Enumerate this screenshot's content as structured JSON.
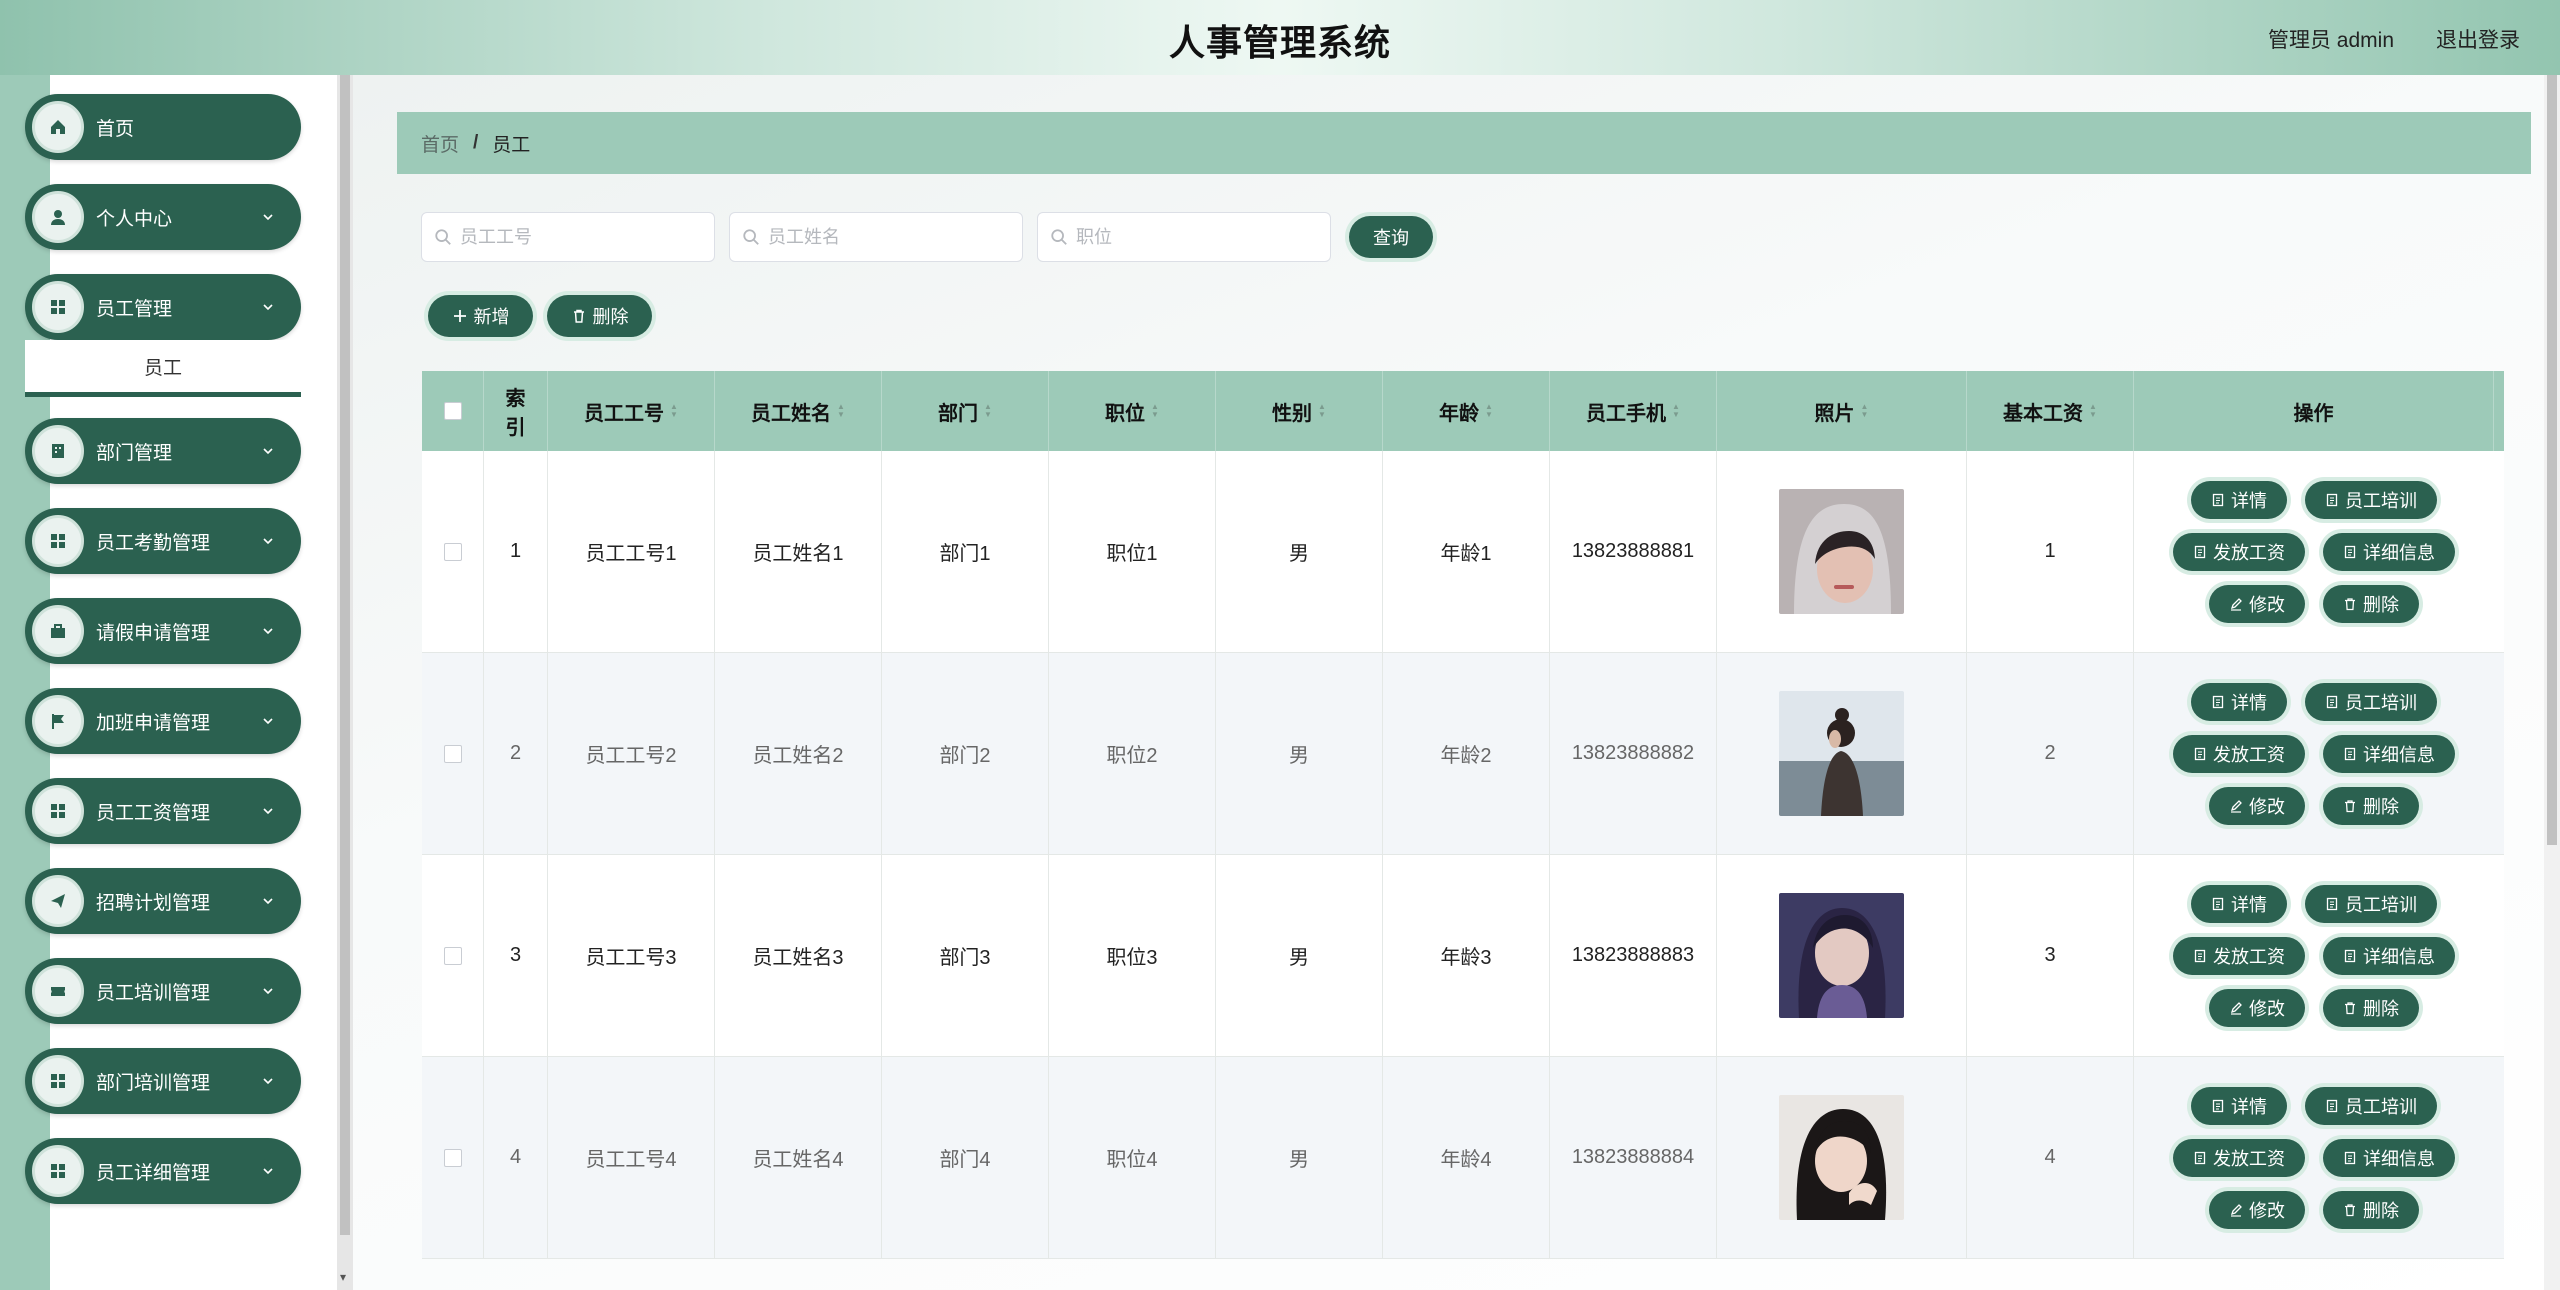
{
  "header": {
    "title": "人事管理系统",
    "user": "管理员 admin",
    "logout": "退出登录"
  },
  "sidebar": {
    "items": [
      {
        "label": "首页",
        "icon": "home-icon",
        "chevron": false
      },
      {
        "label": "个人中心",
        "icon": "user-icon",
        "chevron": true
      },
      {
        "label": "员工管理",
        "icon": "grid-icon",
        "chevron": true
      },
      {
        "label": "部门管理",
        "icon": "building-icon",
        "chevron": true
      },
      {
        "label": "员工考勤管理",
        "icon": "grid-icon",
        "chevron": true
      },
      {
        "label": "请假申请管理",
        "icon": "briefcase-icon",
        "chevron": true
      },
      {
        "label": "加班申请管理",
        "icon": "flag-icon",
        "chevron": true
      },
      {
        "label": "员工工资管理",
        "icon": "grid-icon",
        "chevron": true
      },
      {
        "label": "招聘计划管理",
        "icon": "send-icon",
        "chevron": true
      },
      {
        "label": "员工培训管理",
        "icon": "ticket-icon",
        "chevron": true
      },
      {
        "label": "部门培训管理",
        "icon": "grid-icon",
        "chevron": true
      },
      {
        "label": "员工详细管理",
        "icon": "grid-icon",
        "chevron": true
      }
    ],
    "active_submenu": "员工"
  },
  "breadcrumb": {
    "home": "首页",
    "separator": "/",
    "current": "员工"
  },
  "search": {
    "id_placeholder": "员工工号",
    "name_placeholder": "员工姓名",
    "position_placeholder": "职位",
    "query_label": "查询"
  },
  "toolbar": {
    "add_label": "新增",
    "delete_label": "删除"
  },
  "table": {
    "columns": [
      "索引",
      "员工工号",
      "员工姓名",
      "部门",
      "职位",
      "性别",
      "年龄",
      "员工手机",
      "照片",
      "基本工资",
      "操作"
    ],
    "rows": [
      {
        "index": "1",
        "emp_id": "员工工号1",
        "name": "员工姓名1",
        "dept": "部门1",
        "position": "职位1",
        "gender": "男",
        "age": "年龄1",
        "phone": "13823888881",
        "salary": "1"
      },
      {
        "index": "2",
        "emp_id": "员工工号2",
        "name": "员工姓名2",
        "dept": "部门2",
        "position": "职位2",
        "gender": "男",
        "age": "年龄2",
        "phone": "13823888882",
        "salary": "2"
      },
      {
        "index": "3",
        "emp_id": "员工工号3",
        "name": "员工姓名3",
        "dept": "部门3",
        "position": "职位3",
        "gender": "男",
        "age": "年龄3",
        "phone": "13823888883",
        "salary": "3"
      },
      {
        "index": "4",
        "emp_id": "员工工号4",
        "name": "员工姓名4",
        "dept": "部门4",
        "position": "职位4",
        "gender": "男",
        "age": "年龄4",
        "phone": "13823888884",
        "salary": "4"
      }
    ],
    "actions": {
      "detail": "详情",
      "training": "员工培训",
      "pay": "发放工资",
      "detail_info": "详细信息",
      "edit": "修改",
      "delete": "删除"
    }
  },
  "colors": {
    "primary": "#2b6150",
    "accent": "#9dcab8"
  }
}
